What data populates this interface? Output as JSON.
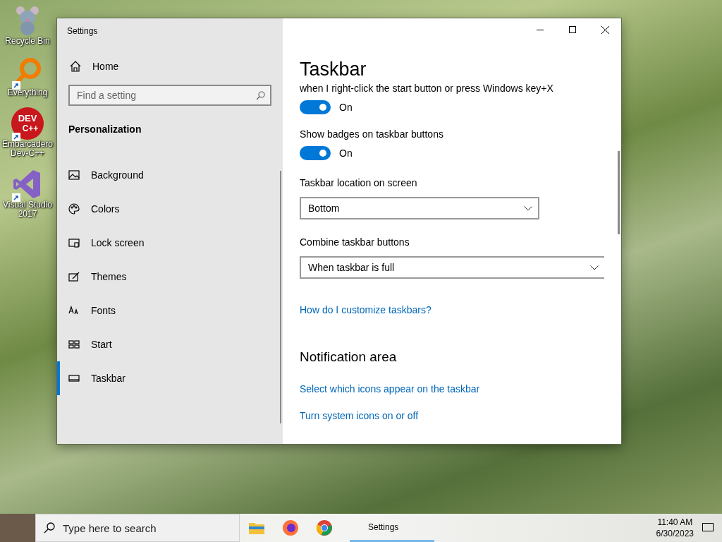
{
  "desktop_icons": [
    {
      "kind": "mouse",
      "label": "Recycle Bin"
    },
    {
      "kind": "magnifier",
      "label": "Everything"
    },
    {
      "kind": "devcpp",
      "label": "Embarcadero Dev-C++",
      "logo_text": [
        "DEV",
        "C++"
      ]
    },
    {
      "kind": "vs",
      "label": "Visual Studio 2017"
    }
  ],
  "window": {
    "title": "Settings"
  },
  "sidebar": {
    "home": "Home",
    "search": {
      "placeholder": "Find a setting"
    },
    "section": "Personalization",
    "items": [
      {
        "label": "Background",
        "selected": false
      },
      {
        "label": "Colors",
        "selected": false
      },
      {
        "label": "Lock screen",
        "selected": false
      },
      {
        "label": "Themes",
        "selected": false
      },
      {
        "label": "Fonts",
        "selected": false
      },
      {
        "label": "Start",
        "selected": false
      },
      {
        "label": "Taskbar",
        "selected": true
      }
    ]
  },
  "content": {
    "title": "Taskbar",
    "settings": [
      {
        "kind": "toggle",
        "label": "when I right-click the start button or press Windows key+X",
        "on": true,
        "state_text": "On"
      },
      {
        "kind": "toggle",
        "label": "Show badges on taskbar buttons",
        "on": true,
        "state_text": "On"
      },
      {
        "kind": "dropdown",
        "label": "Taskbar location on screen",
        "value": "Bottom"
      },
      {
        "kind": "dropdown",
        "label": "Combine taskbar buttons",
        "value": "When taskbar is full"
      },
      {
        "kind": "link",
        "label": "How do I customize taskbars?"
      }
    ],
    "sections": [
      {
        "title": "Notification area",
        "links": [
          "Select which icons appear on the taskbar",
          "Turn system icons on or off"
        ]
      }
    ]
  },
  "taskbar": {
    "search": {
      "placeholder": "Type here to search"
    },
    "apps": [
      {
        "kind": "folder"
      },
      {
        "kind": "firefox"
      },
      {
        "kind": "chrome"
      }
    ],
    "window_button": {
      "label": "Settings",
      "selected": true
    },
    "time": "11:40 AM",
    "date": "6/30/2023"
  }
}
